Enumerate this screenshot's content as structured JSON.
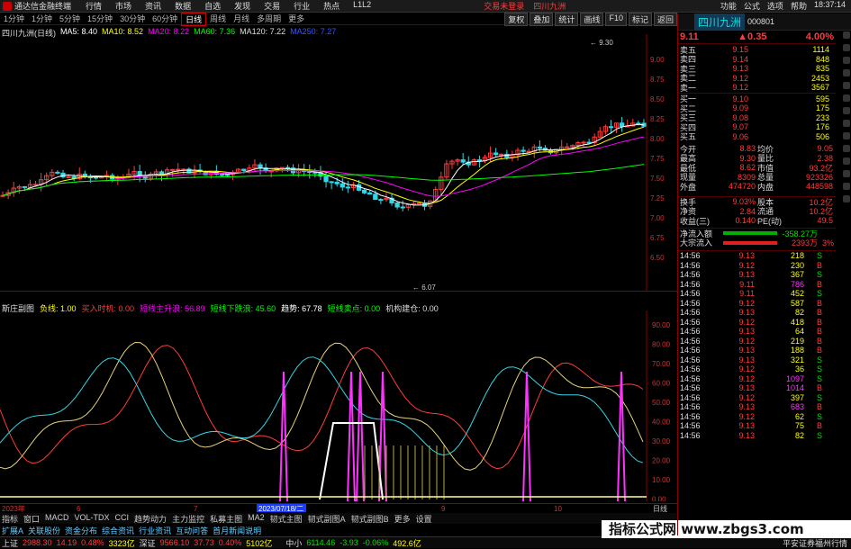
{
  "app": {
    "title": "通达信金融终端",
    "menu": [
      "行情",
      "市场",
      "资讯",
      "数据",
      "自选",
      "发现",
      "交易",
      "行业",
      "热点",
      "L1L2"
    ],
    "login": "交易未登录",
    "stock_tag": "四川九洲",
    "right": [
      "功能",
      "公式",
      "选项",
      "帮助",
      "18:37:14"
    ]
  },
  "periods": [
    "1分钟",
    "1分钟",
    "5分钟",
    "15分钟",
    "30分钟",
    "60分钟",
    "日线",
    "周线",
    "月线",
    "多周期",
    "更多"
  ],
  "selected_period": "日线",
  "tools": [
    "复权",
    "叠加",
    "统计",
    "画线",
    "F10",
    "标记",
    "返回"
  ],
  "ma": {
    "label": "四川九洲(日线)",
    "items": [
      {
        "t": "MA5: 8.40",
        "c": "#ffffff"
      },
      {
        "t": "MA10: 8.52",
        "c": "#ffff00"
      },
      {
        "t": "MA20: 8.22",
        "c": "#ff00ff"
      },
      {
        "t": "MA60: 7.36",
        "c": "#00ff00"
      },
      {
        "t": "MA120: 7.22",
        "c": "#dddddd"
      },
      {
        "t": "MA250: 7.27",
        "c": "#3355ff"
      }
    ]
  },
  "kaxis": [
    "9.00",
    "8.75",
    "8.50",
    "8.25",
    "8.00",
    "7.75",
    "7.50",
    "7.25",
    "7.00",
    "6.75",
    "6.50"
  ],
  "kmarks": {
    "high": "9.30",
    "low": "6.07"
  },
  "ind": {
    "items": [
      {
        "t": "斯庄副图",
        "c": "#dddddd"
      },
      {
        "t": "负线: 1.00",
        "c": "#ffff00"
      },
      {
        "t": "买入时机: 0.00",
        "c": "#ff3b3b"
      },
      {
        "t": "短线主升浪: 56.89",
        "c": "#ff00ff"
      },
      {
        "t": "短线下跌浪: 45.60",
        "c": "#00ff00"
      },
      {
        "t": "趋势: 67.78",
        "c": "#ffffff"
      },
      {
        "t": "短线卖点: 0.00",
        "c": "#00ff00"
      },
      {
        "t": "机构建仓: 0.00",
        "c": "#dddddd"
      }
    ]
  },
  "iaxis": [
    "90.00",
    "80.00",
    "70.00",
    "60.00",
    "50.00",
    "40.00",
    "30.00",
    "20.00",
    "10.00",
    "0.00"
  ],
  "dates": {
    "year": "2023年",
    "months": [
      "6",
      "7",
      "8",
      "9",
      "10"
    ],
    "cursor": "2023/07/18/二",
    "label": "日线"
  },
  "tabs": [
    "指标",
    "窗口",
    "MACD",
    "VOL-TDX",
    "CCI",
    "趋势动力",
    "主力监控",
    "私募主图",
    "MA2",
    "韧式主图",
    "韧式副图A",
    "韧式副图B",
    "更多",
    "设置"
  ],
  "tabs2": [
    "扩展A",
    "关联股份",
    "资金分布",
    "综合资讯",
    "行业资讯",
    "互动问答",
    "首月新闻说明"
  ],
  "status": {
    "sh_label": "上证",
    "sh": "2988.30",
    "sh_chg": "14.19",
    "sh_pct": "0.48%",
    "sh_amt": "3323亿",
    "sz_label": "深证",
    "sz": "9566.10",
    "sz_chg": "37.73",
    "sz_pct": "0.40%",
    "sz_amt": "5102亿",
    "zx_label": "中小",
    "zx": "6114.46",
    "zx_chg": "-3.93",
    "zx_pct": "-0.06%",
    "zx_amt": "492.6亿",
    "broker": "平安证券福州行情"
  },
  "watermark": "指标公式网 www.zbgs3.com",
  "stock": {
    "name": "四川九洲",
    "code": "000801",
    "price": "9.11",
    "chg": "▲0.35",
    "pct": "4.00%"
  },
  "sells": [
    {
      "l": "卖五",
      "p": "9.15",
      "v": "1114"
    },
    {
      "l": "卖四",
      "p": "9.14",
      "v": "848"
    },
    {
      "l": "卖三",
      "p": "9.13",
      "v": "835"
    },
    {
      "l": "卖二",
      "p": "9.12",
      "v": "2453"
    },
    {
      "l": "卖一",
      "p": "9.12",
      "v": "3567"
    }
  ],
  "buys": [
    {
      "l": "买一",
      "p": "9.10",
      "v": "595"
    },
    {
      "l": "买二",
      "p": "9.09",
      "v": "175"
    },
    {
      "l": "买三",
      "p": "9.08",
      "v": "233"
    },
    {
      "l": "买四",
      "p": "9.07",
      "v": "176"
    },
    {
      "l": "买五",
      "p": "9.06",
      "v": "506"
    }
  ],
  "stats": [
    [
      "今开",
      "8.83",
      "均价",
      "9.05"
    ],
    [
      "最高",
      "9.30",
      "量比",
      "2.38"
    ],
    [
      "最低",
      "8.62",
      "市值",
      "93.2亿"
    ],
    [
      "现量",
      "8309",
      "总量",
      "923326"
    ],
    [
      "外盘",
      "474720",
      "内盘",
      "448598"
    ]
  ],
  "stats2": [
    [
      "换手",
      "9.03%",
      "股本",
      "10.2亿"
    ],
    [
      "净资",
      "2.84",
      "流通",
      "10.2亿"
    ],
    [
      "收益(三)",
      "0.140",
      "PE(动)",
      "49.5"
    ]
  ],
  "flow": [
    {
      "l": "净流入额",
      "v": "-358.27万"
    },
    {
      "l": "大宗流入",
      "v": "2393万",
      "p": "3%"
    }
  ],
  "ticks": [
    [
      "14:56",
      "9.13",
      "218",
      "S"
    ],
    [
      "14:56",
      "9.12",
      "230",
      "B"
    ],
    [
      "14:56",
      "9.13",
      "367",
      "S"
    ],
    [
      "14:56",
      "9.11",
      "786",
      "B"
    ],
    [
      "14:56",
      "9.11",
      "452",
      "S"
    ],
    [
      "14:56",
      "9.12",
      "587",
      "B"
    ],
    [
      "14:56",
      "9.13",
      "82",
      "B"
    ],
    [
      "14:56",
      "9.12",
      "418",
      "B"
    ],
    [
      "14:56",
      "9.13",
      "64",
      "B"
    ],
    [
      "14:56",
      "9.12",
      "219",
      "B"
    ],
    [
      "14:56",
      "9.13",
      "188",
      "B"
    ],
    [
      "14:56",
      "9.13",
      "321",
      "S"
    ],
    [
      "14:56",
      "9.12",
      "36",
      "S"
    ],
    [
      "14:56",
      "9.12",
      "1097",
      "S"
    ],
    [
      "14:56",
      "9.13",
      "1014",
      "B"
    ],
    [
      "14:56",
      "9.12",
      "397",
      "S"
    ],
    [
      "14:56",
      "9.13",
      "683",
      "B"
    ],
    [
      "14:56",
      "9.12",
      "62",
      "S"
    ],
    [
      "14:56",
      "9.13",
      "75",
      "B"
    ],
    [
      "14:56",
      "9.13",
      "82",
      "S"
    ]
  ]
}
